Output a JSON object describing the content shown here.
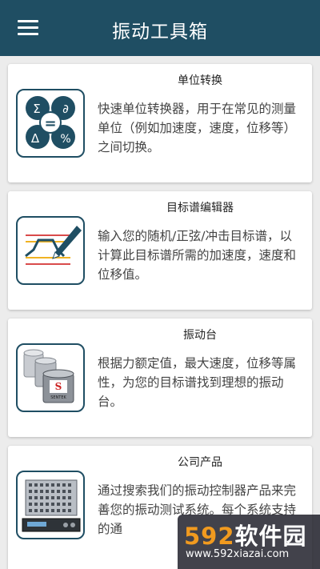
{
  "app": {
    "title": "振动工具箱",
    "accent_color": "#1f4e63",
    "menu_icon": "hamburger-menu-icon"
  },
  "cards": [
    {
      "title": "单位转换",
      "description": "快速单位转换器，用于在常见的测量单位（例如加速度，速度，位移等）之间切换。",
      "icon": "unit-converter-icon",
      "icon_symbols": [
        "Σ",
        "∂",
        "=",
        "Δ",
        "%"
      ]
    },
    {
      "title": "目标谱编辑器",
      "description": "输入您的随机/正弦/冲击目标谱，以计算此目标谱所需的加速度，速度和位移值。",
      "icon": "spectrum-editor-icon"
    },
    {
      "title": "振动台",
      "description": "根据力额定值，最大速度，位移等属性，为您的目标谱找到理想的振动台。",
      "icon": "shaker-table-icon",
      "icon_symbols": [
        "S",
        "SENTEK"
      ]
    },
    {
      "title": "公司产品",
      "description": "通过搜索我们的振动控制器产品来完善您的振动测试系统。每个系统支持的通",
      "icon": "controller-product-icon"
    }
  ],
  "watermark": {
    "number": "592",
    "text": "软件园",
    "url": "www.592xiazai.com"
  }
}
